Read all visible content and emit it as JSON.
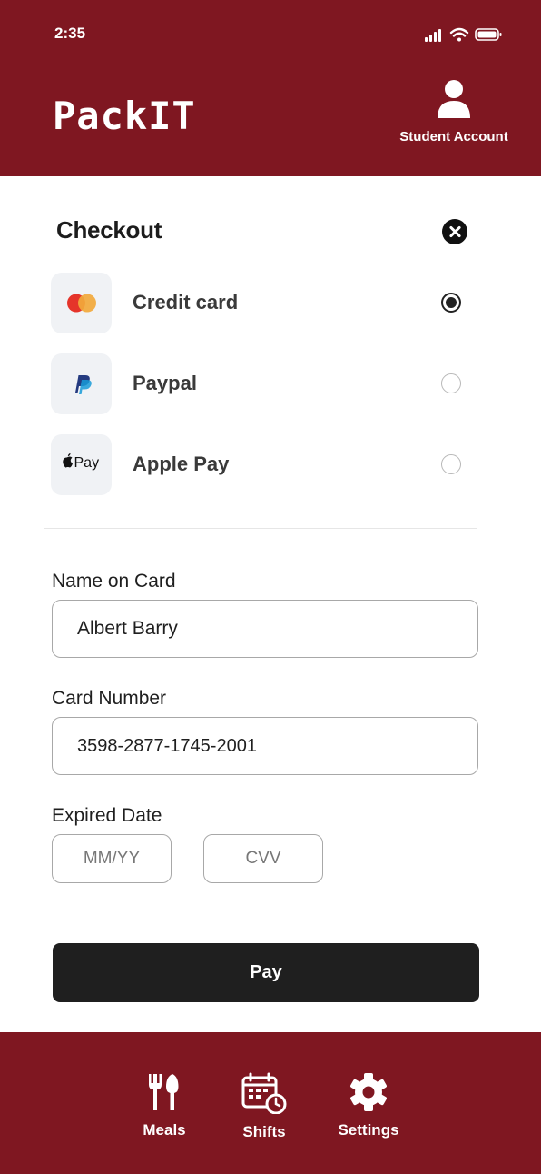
{
  "status_bar": {
    "time": "2:35"
  },
  "header": {
    "brand": "PackIT",
    "account_label": "Student Account",
    "account_icon": "user-icon"
  },
  "checkout": {
    "title": "Checkout",
    "close_icon": "close-icon",
    "methods": [
      {
        "label": "Credit card",
        "icon": "mastercard-icon",
        "selected": true
      },
      {
        "label": "Paypal",
        "icon": "paypal-icon",
        "selected": false
      },
      {
        "label": "Apple Pay",
        "icon": "apple-pay-icon",
        "icon_text": "Pay",
        "selected": false
      }
    ]
  },
  "form": {
    "name_label": "Name on Card",
    "name_value": "Albert Barry",
    "card_label": "Card Number",
    "card_value": "3598-2877-1745-2001",
    "expiry_label": "Expired Date",
    "expiry_placeholder": "MM/YY",
    "cvv_placeholder": "CVV",
    "pay_label": "Pay"
  },
  "tabbar": {
    "items": [
      {
        "label": "Meals",
        "icon": "fork-knife-icon"
      },
      {
        "label": "Shifts",
        "icon": "calendar-clock-icon"
      },
      {
        "label": "Settings",
        "icon": "gear-icon"
      }
    ]
  },
  "colors": {
    "brand": "#7f1721",
    "button": "#1f1f1f"
  }
}
